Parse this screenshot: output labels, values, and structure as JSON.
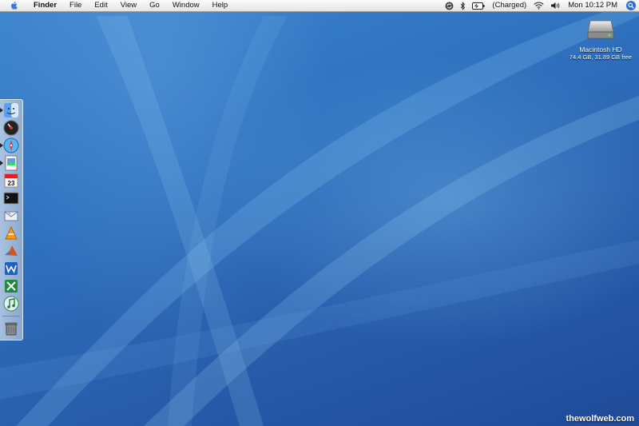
{
  "menubar": {
    "app_name": "Finder",
    "menus": [
      "File",
      "Edit",
      "View",
      "Go",
      "Window",
      "Help"
    ],
    "battery_status": "(Charged)",
    "clock": "Mon 10:12 PM",
    "status_icons": [
      "sync-icon",
      "bluetooth-icon",
      "battery-icon",
      "wifi-icon",
      "volume-icon",
      "spotlight-icon"
    ]
  },
  "desktop": {
    "drive": {
      "label": "Macintosh HD",
      "info": "74.4 GB, 31.89 GB free"
    },
    "watermark": "thewolfweb.com",
    "background_colors": [
      "#3f86cf",
      "#2a62b0",
      "#1f4a98"
    ]
  },
  "dock": {
    "items": [
      {
        "name": "finder-icon",
        "running": true
      },
      {
        "name": "dashboard-icon",
        "running": false
      },
      {
        "name": "safari-icon",
        "running": true
      },
      {
        "name": "preview-icon",
        "running": true
      },
      {
        "name": "ical-icon",
        "running": false,
        "badge_text": "23"
      },
      {
        "name": "terminal-icon",
        "running": false
      },
      {
        "name": "mail-icon",
        "running": false
      },
      {
        "name": "vlc-icon",
        "running": false
      },
      {
        "name": "matlab-icon",
        "running": false
      },
      {
        "name": "word-icon",
        "running": false
      },
      {
        "name": "excel-icon",
        "running": false
      },
      {
        "name": "itunes-icon",
        "running": false
      },
      {
        "name": "trash-icon",
        "running": false
      }
    ]
  }
}
